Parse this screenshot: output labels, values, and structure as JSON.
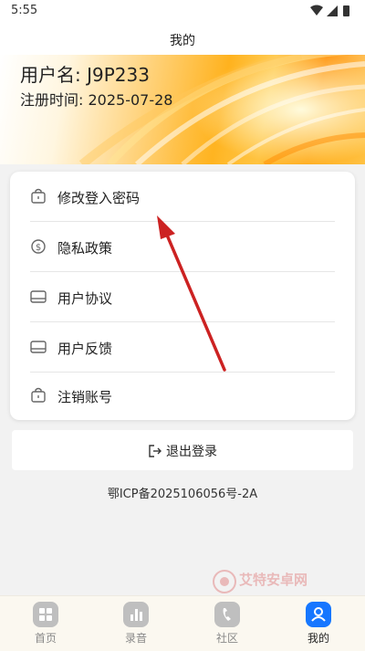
{
  "status": {
    "time": "5:55"
  },
  "nav": {
    "title": "我的"
  },
  "profile": {
    "username": "用户名: J9P233",
    "reg_time": "注册时间: 2025-07-28"
  },
  "menu": {
    "items": [
      {
        "label": "修改登入密码",
        "icon": "lock-icon"
      },
      {
        "label": "隐私政策",
        "icon": "dollar-circle-icon"
      },
      {
        "label": "用户协议",
        "icon": "card-icon"
      },
      {
        "label": "用户反馈",
        "icon": "card-icon"
      },
      {
        "label": "注销账号",
        "icon": "lock-icon"
      }
    ]
  },
  "logout": {
    "label": "退出登录",
    "icon": "logout-icon"
  },
  "footer": {
    "icp": "鄂ICP备2025106056号-2A"
  },
  "watermark": {
    "text": "艾特安卓网"
  },
  "tabs": [
    {
      "label": "首页",
      "icon": "grid-icon",
      "active": false
    },
    {
      "label": "录音",
      "icon": "bar-chart-icon",
      "active": false
    },
    {
      "label": "社区",
      "icon": "phone-icon",
      "active": false
    },
    {
      "label": "我的",
      "icon": "user-icon",
      "active": true
    }
  ],
  "colors": {
    "accent": "#1677ff",
    "arrow": "#cc2222",
    "banner": "#ffb21e"
  }
}
